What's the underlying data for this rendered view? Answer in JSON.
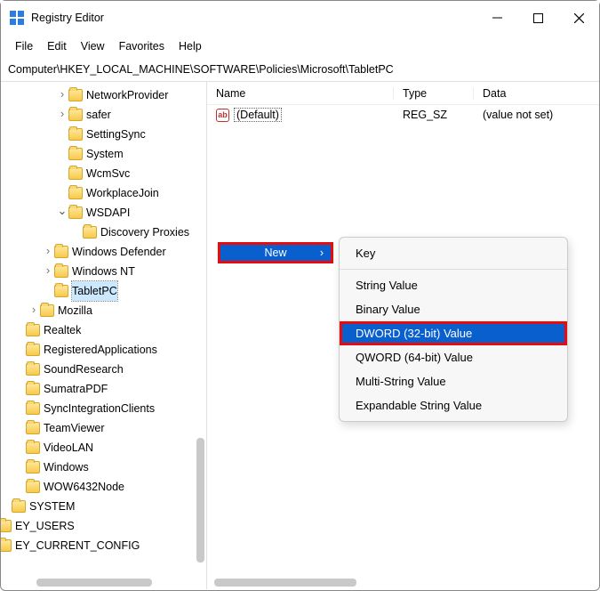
{
  "title": "Registry Editor",
  "menu": [
    "File",
    "Edit",
    "View",
    "Favorites",
    "Help"
  ],
  "address": "Computer\\HKEY_LOCAL_MACHINE\\SOFTWARE\\Policies\\Microsoft\\TabletPC",
  "columns": {
    "name": "Name",
    "type": "Type",
    "data": "Data"
  },
  "entry": {
    "name": "(Default)",
    "type": "REG_SZ",
    "data": "(value not set)"
  },
  "ctx": {
    "new": "New",
    "items": {
      "key": "Key",
      "string": "String Value",
      "binary": "Binary Value",
      "dword": "DWORD (32-bit) Value",
      "qword": "QWORD (64-bit) Value",
      "multi": "Multi-String Value",
      "expand": "Expandable String Value"
    }
  },
  "tree": [
    {
      "label": "NetworkProvider",
      "indent": 5,
      "tw": "closed"
    },
    {
      "label": "safer",
      "indent": 5,
      "tw": "closed"
    },
    {
      "label": "SettingSync",
      "indent": 5,
      "tw": "none"
    },
    {
      "label": "System",
      "indent": 5,
      "tw": "none"
    },
    {
      "label": "WcmSvc",
      "indent": 5,
      "tw": "none"
    },
    {
      "label": "WorkplaceJoin",
      "indent": 5,
      "tw": "none"
    },
    {
      "label": "WSDAPI",
      "indent": 5,
      "tw": "open"
    },
    {
      "label": "Discovery Proxies",
      "indent": 6,
      "tw": "none"
    },
    {
      "label": "Windows Defender",
      "indent": 4,
      "tw": "closed"
    },
    {
      "label": "Windows NT",
      "indent": 4,
      "tw": "closed"
    },
    {
      "label": "TabletPC",
      "indent": 4,
      "tw": "none",
      "selected": true
    },
    {
      "label": "Mozilla",
      "indent": 3,
      "tw": "closed"
    },
    {
      "label": "Realtek",
      "indent": 2,
      "tw": "none"
    },
    {
      "label": "RegisteredApplications",
      "indent": 2,
      "tw": "none"
    },
    {
      "label": "SoundResearch",
      "indent": 2,
      "tw": "none"
    },
    {
      "label": "SumatraPDF",
      "indent": 2,
      "tw": "none"
    },
    {
      "label": "SyncIntegrationClients",
      "indent": 2,
      "tw": "none"
    },
    {
      "label": "TeamViewer",
      "indent": 2,
      "tw": "none"
    },
    {
      "label": "VideoLAN",
      "indent": 2,
      "tw": "none"
    },
    {
      "label": "Windows",
      "indent": 2,
      "tw": "none"
    },
    {
      "label": "WOW6432Node",
      "indent": 2,
      "tw": "none"
    },
    {
      "label": "SYSTEM",
      "indent": 1,
      "tw": "none"
    },
    {
      "label": "EY_USERS",
      "indent": 0,
      "tw": "none"
    },
    {
      "label": "EY_CURRENT_CONFIG",
      "indent": 0,
      "tw": "none"
    }
  ]
}
